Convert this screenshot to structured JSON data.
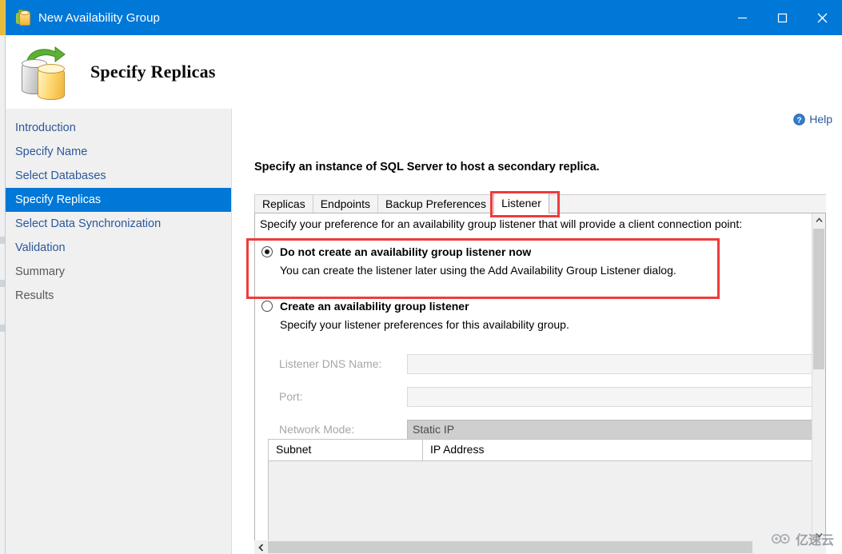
{
  "window": {
    "title": "New Availability Group",
    "icon": "database-group-icon",
    "controls": {
      "minimize": "minimize-icon",
      "maximize": "maximize-icon",
      "close": "close-icon"
    }
  },
  "header": {
    "title": "Specify Replicas",
    "icon": "replication-databases-icon"
  },
  "sidebar": {
    "items": [
      {
        "label": "Introduction",
        "state": "link"
      },
      {
        "label": "Specify Name",
        "state": "link"
      },
      {
        "label": "Select Databases",
        "state": "link"
      },
      {
        "label": "Specify Replicas",
        "state": "selected"
      },
      {
        "label": "Select Data Synchronization",
        "state": "link"
      },
      {
        "label": "Validation",
        "state": "link"
      },
      {
        "label": "Summary",
        "state": "disabled"
      },
      {
        "label": "Results",
        "state": "disabled"
      }
    ]
  },
  "content": {
    "help_label": "Help",
    "heading": "Specify an instance of SQL Server to host a secondary replica.",
    "tabs": [
      {
        "label": "Replicas",
        "active": false
      },
      {
        "label": "Endpoints",
        "active": false
      },
      {
        "label": "Backup Preferences",
        "active": false
      },
      {
        "label": "Listener",
        "active": true
      }
    ],
    "panel": {
      "description": "Specify your preference for an availability group listener that will provide a client connection point:",
      "options": [
        {
          "label": "Do not create an availability group listener now",
          "sublabel": "You can create the listener later using the Add Availability Group Listener dialog.",
          "selected": true
        },
        {
          "label": "Create an availability group listener",
          "sublabel": "Specify your listener preferences for this availability group.",
          "selected": false
        }
      ],
      "fields": [
        {
          "label": "Listener DNS Name:",
          "value": "",
          "type": "text",
          "disabled": true
        },
        {
          "label": "Port:",
          "value": "",
          "type": "text",
          "disabled": true
        },
        {
          "label": "Network Mode:",
          "value": "Static IP",
          "type": "select",
          "disabled": true
        }
      ],
      "grid": {
        "columns": [
          "Subnet",
          "IP Address"
        ],
        "rows": []
      }
    }
  },
  "annotations": {
    "accent_color": "#ef3b3b",
    "boxes": [
      "listener-tab",
      "do-not-create-option"
    ]
  },
  "watermark": {
    "text": "亿速云",
    "icon": "cloud-logo-icon"
  },
  "colors": {
    "titlebar": "#0078d7",
    "selection": "#0078d7",
    "link": "#2b579a",
    "annotation": "#ef3b3b"
  }
}
